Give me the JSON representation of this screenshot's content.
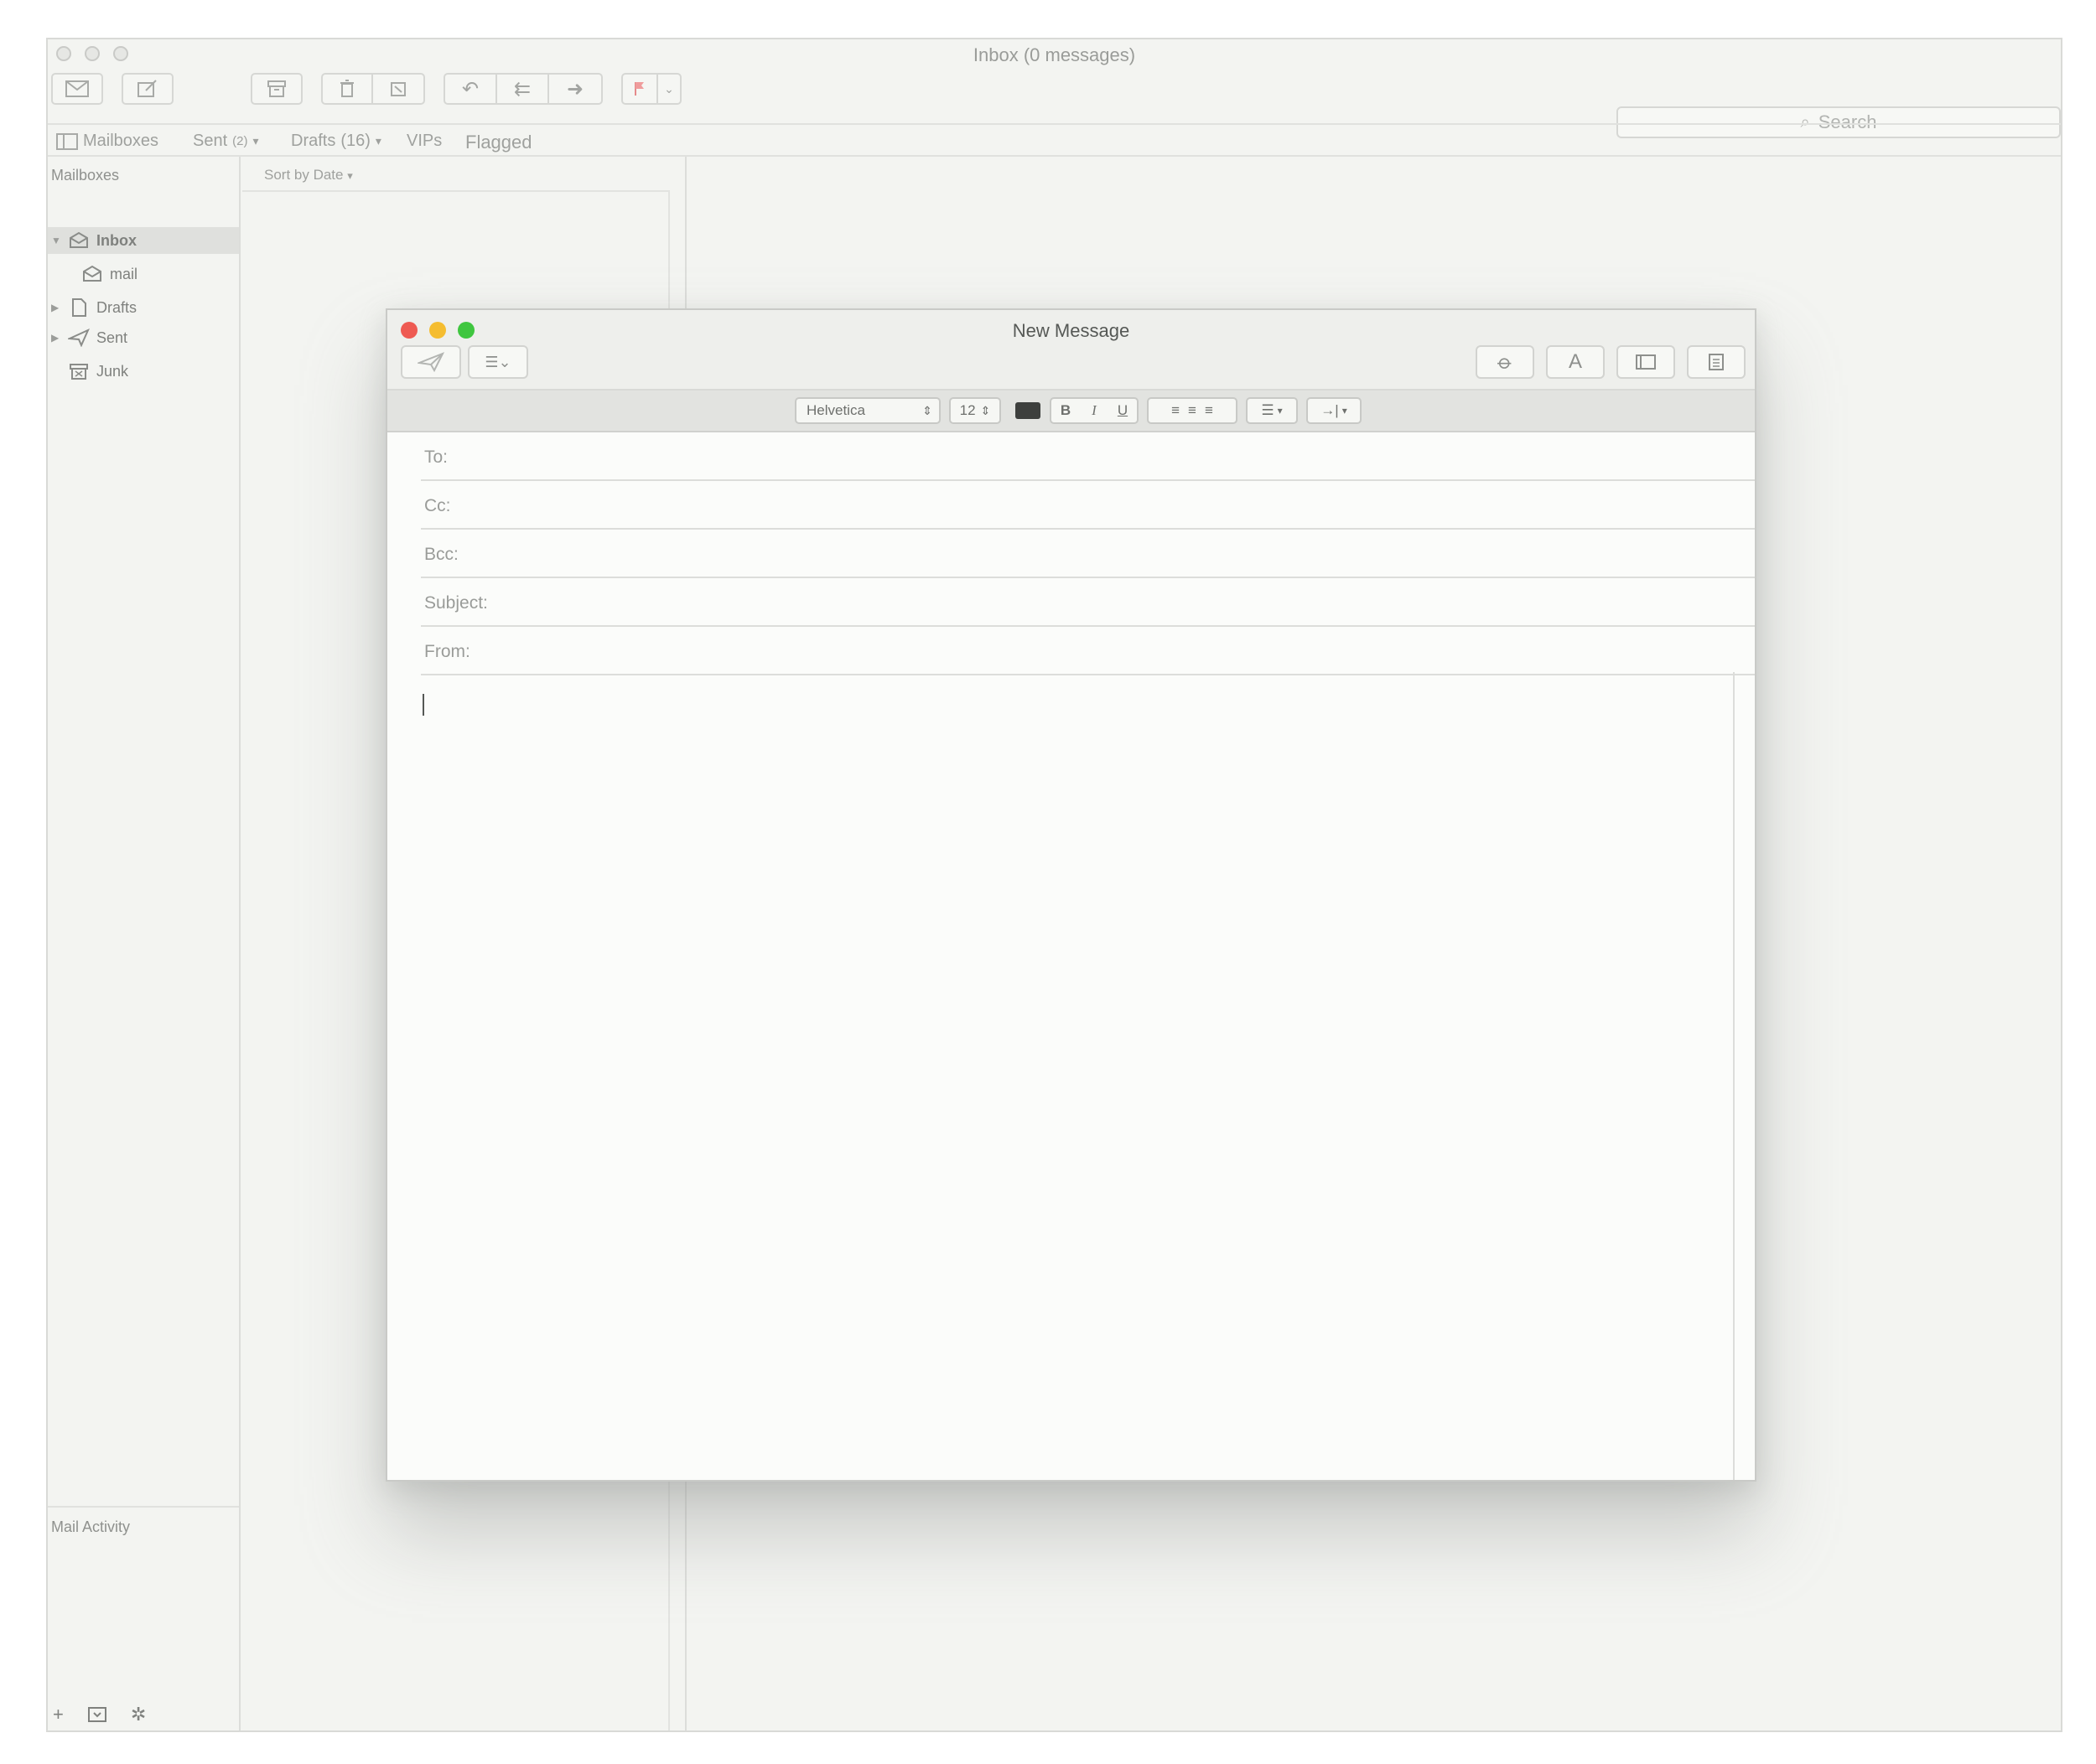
{
  "window": {
    "title": "Inbox (0 messages)"
  },
  "toolbar": {
    "search_placeholder": "Search",
    "icons": [
      "get-mail-icon",
      "compose-icon",
      "archive-icon",
      "delete-icon",
      "junk-icon",
      "reply-icon",
      "reply-all-icon",
      "forward-icon",
      "flag-icon"
    ]
  },
  "favorites": {
    "mailboxes": "Mailboxes",
    "sent": "Sent",
    "sent_count": "(2)",
    "drafts": "Drafts",
    "drafts_count": "(16)",
    "vips": "VIPs",
    "flagged": "Flagged"
  },
  "sidebar": {
    "header": "Mailboxes",
    "items": [
      {
        "label": "Inbox",
        "icon": "inbox-icon",
        "selected": true
      },
      {
        "label": "mail",
        "icon": "mailbox-icon"
      },
      {
        "label": "Drafts",
        "icon": "drafts-icon"
      },
      {
        "label": "Sent",
        "icon": "sent-icon"
      },
      {
        "label": "Junk",
        "icon": "junk-icon"
      }
    ],
    "activity": "Mail Activity"
  },
  "message_list": {
    "sort_label": "Sort by Date"
  },
  "compose": {
    "title": "New Message",
    "traffic_colors": [
      "#ee5a52",
      "#f5bd30",
      "#3fc63f"
    ],
    "format": {
      "font": "Helvetica",
      "size": "12",
      "color": "#3d3f3d",
      "bold": "B",
      "italic": "I",
      "underline": "U"
    },
    "fields": [
      {
        "label": "To:",
        "value": ""
      },
      {
        "label": "Cc:",
        "value": ""
      },
      {
        "label": "Bcc:",
        "value": ""
      },
      {
        "label": "Subject:",
        "value": ""
      },
      {
        "label": "From:",
        "value": ""
      }
    ],
    "body": ""
  }
}
